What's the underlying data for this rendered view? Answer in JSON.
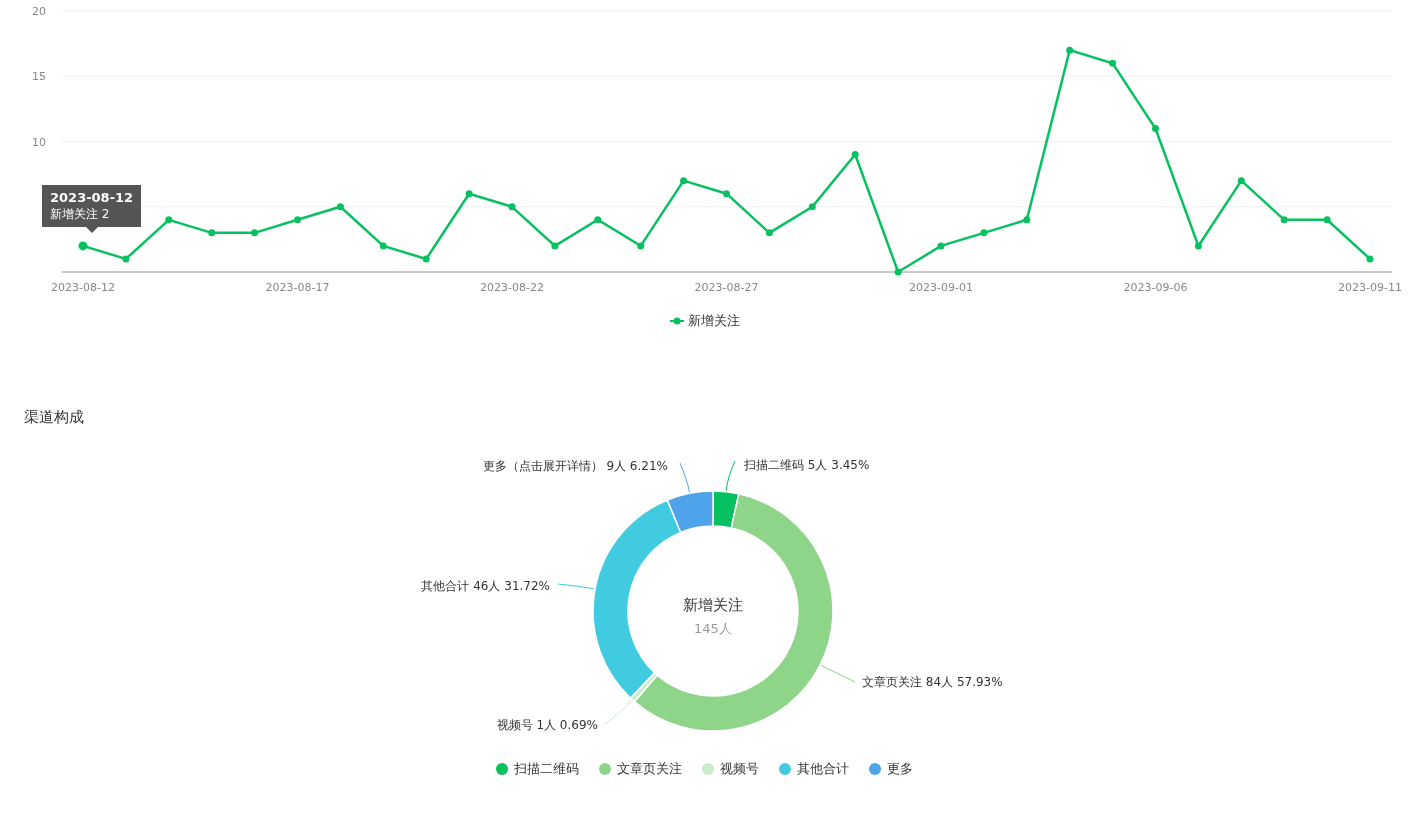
{
  "trend": {
    "tooltip": {
      "date": "2023-08-12",
      "text": "新增关注 2"
    },
    "chart_data": {
      "type": "line",
      "categories": [
        "2023-08-12",
        null,
        null,
        null,
        null,
        "2023-08-17",
        null,
        null,
        null,
        null,
        "2023-08-22",
        null,
        null,
        null,
        null,
        "2023-08-27",
        null,
        null,
        null,
        null,
        "2023-09-01",
        null,
        null,
        null,
        null,
        "2023-09-06",
        null,
        null,
        null,
        null,
        "2023-09-11"
      ],
      "series": [
        {
          "name": "新增关注",
          "color": "#07c160",
          "marker": true,
          "values": [
            2,
            1,
            4,
            3,
            3,
            4,
            5,
            2,
            1,
            6,
            5,
            2,
            4,
            2,
            7,
            6,
            3,
            5,
            9,
            0,
            2,
            3,
            4,
            17,
            16,
            11,
            2,
            7,
            4,
            4,
            1
          ]
        }
      ],
      "ylim": [
        0,
        20
      ],
      "yticks": [
        10,
        15,
        20
      ]
    }
  },
  "channels": {
    "title": "渠道构成",
    "center_total": "145人",
    "slice_labels": [
      "扫描二维码 5人 3.45%",
      "文章页关注 84人 57.93%",
      "视频号 1人 0.69%",
      "其他合计 46人 31.72%",
      "更多（点击展开详情） 9人 6.21%"
    ],
    "chart_data": {
      "type": "donut",
      "categories": [
        "扫描二维码",
        "文章页关注",
        "视频号",
        "其他合计",
        "更多"
      ],
      "colors": [
        "#07c160",
        "#8ed58a",
        "#c9eccb",
        "#40cbe0",
        "#4ea3ea"
      ],
      "series": [
        {
          "name": "新增关注",
          "values": [
            3.45,
            57.93,
            0.69,
            31.72,
            6.21
          ]
        }
      ]
    }
  }
}
